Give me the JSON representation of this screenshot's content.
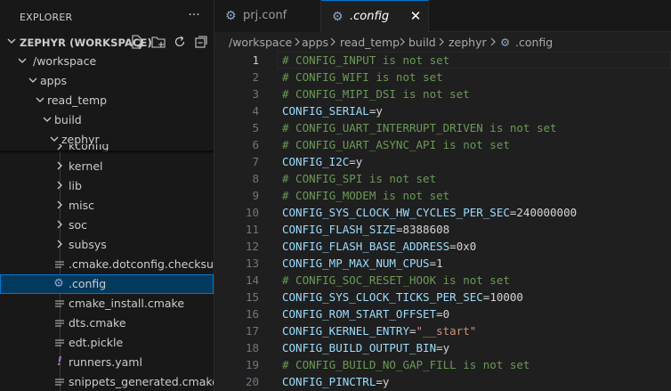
{
  "explorer": {
    "title": "EXPLORER",
    "more_icon": "ellipsis-icon",
    "workspace_label": "ZEPHYR (WORKSPACE)",
    "workspace_actions": [
      "new-file-icon",
      "new-folder-icon",
      "refresh-icon",
      "collapse-all-icon"
    ],
    "tree": [
      {
        "label": "/workspace",
        "type": "folder",
        "expanded": true,
        "depth": 1
      },
      {
        "label": "apps",
        "type": "folder",
        "expanded": true,
        "depth": 2
      },
      {
        "label": "read_temp",
        "type": "folder",
        "expanded": true,
        "depth": 3
      },
      {
        "label": "build",
        "type": "folder",
        "expanded": true,
        "depth": 4
      },
      {
        "label": "zephyr",
        "type": "folder",
        "expanded": true,
        "depth": 5
      },
      {
        "label": "kconfig",
        "type": "folder",
        "expanded": false,
        "depth": 6
      },
      {
        "label": "kernel",
        "type": "folder",
        "expanded": false,
        "depth": 6
      },
      {
        "label": "lib",
        "type": "folder",
        "expanded": false,
        "depth": 6
      },
      {
        "label": "misc",
        "type": "folder",
        "expanded": false,
        "depth": 6
      },
      {
        "label": "soc",
        "type": "folder",
        "expanded": false,
        "depth": 6
      },
      {
        "label": "subsys",
        "type": "folder",
        "expanded": false,
        "depth": 6
      },
      {
        "label": ".cmake.dotconfig.checksum",
        "type": "file",
        "icon": "lines-icon",
        "depth": 6
      },
      {
        "label": ".config",
        "type": "file",
        "icon": "gear-icon",
        "selected": true,
        "depth": 6
      },
      {
        "label": "cmake_install.cmake",
        "type": "file",
        "icon": "lines-icon",
        "depth": 6
      },
      {
        "label": "dts.cmake",
        "type": "file",
        "icon": "lines-icon",
        "depth": 6
      },
      {
        "label": "edt.pickle",
        "type": "file",
        "icon": "lines-icon",
        "depth": 6
      },
      {
        "label": "runners.yaml",
        "type": "file",
        "icon": "exclamation-icon",
        "depth": 6
      },
      {
        "label": "snippets_generated.cmake",
        "type": "file",
        "icon": "lines-icon",
        "depth": 6
      }
    ]
  },
  "tabs": [
    {
      "label": "prj.conf",
      "icon": "gear-icon",
      "active": false
    },
    {
      "label": ".config",
      "icon": "gear-icon",
      "active": true,
      "close_icon": "close-icon"
    }
  ],
  "breadcrumb": [
    "/workspace",
    "apps",
    "read_temp",
    "build",
    "zephyr",
    ".config"
  ],
  "editor": {
    "active_line": 1,
    "lines": [
      {
        "n": "1",
        "kind": "comment",
        "text": "# CONFIG_INPUT is not set"
      },
      {
        "n": "2",
        "kind": "comment",
        "text": "# CONFIG_WIFI is not set"
      },
      {
        "n": "3",
        "kind": "comment",
        "text": "# CONFIG_MIPI_DSI is not set"
      },
      {
        "n": "4",
        "kind": "kv",
        "key": "CONFIG_SERIAL",
        "value": "y"
      },
      {
        "n": "5",
        "kind": "comment",
        "text": "# CONFIG_UART_INTERRUPT_DRIVEN is not set"
      },
      {
        "n": "6",
        "kind": "comment",
        "text": "# CONFIG_UART_ASYNC_API is not set"
      },
      {
        "n": "7",
        "kind": "kv",
        "key": "CONFIG_I2C",
        "value": "y"
      },
      {
        "n": "8",
        "kind": "comment",
        "text": "# CONFIG_SPI is not set"
      },
      {
        "n": "9",
        "kind": "comment",
        "text": "# CONFIG_MODEM is not set"
      },
      {
        "n": "10",
        "kind": "kv",
        "key": "CONFIG_SYS_CLOCK_HW_CYCLES_PER_SEC",
        "value": "240000000"
      },
      {
        "n": "11",
        "kind": "kv",
        "key": "CONFIG_FLASH_SIZE",
        "value": "8388608"
      },
      {
        "n": "12",
        "kind": "kv",
        "key": "CONFIG_FLASH_BASE_ADDRESS",
        "value": "0x0"
      },
      {
        "n": "13",
        "kind": "kv",
        "key": "CONFIG_MP_MAX_NUM_CPUS",
        "value": "1"
      },
      {
        "n": "14",
        "kind": "comment",
        "text": "# CONFIG_SOC_RESET_HOOK is not set"
      },
      {
        "n": "15",
        "kind": "kv",
        "key": "CONFIG_SYS_CLOCK_TICKS_PER_SEC",
        "value": "10000"
      },
      {
        "n": "16",
        "kind": "kv",
        "key": "CONFIG_ROM_START_OFFSET",
        "value": "0"
      },
      {
        "n": "17",
        "kind": "kvs",
        "key": "CONFIG_KERNEL_ENTRY",
        "value": "\"__start\""
      },
      {
        "n": "18",
        "kind": "kv",
        "key": "CONFIG_BUILD_OUTPUT_BIN",
        "value": "y"
      },
      {
        "n": "19",
        "kind": "comment",
        "text": "# CONFIG_BUILD_NO_GAP_FILL is not set"
      },
      {
        "n": "20",
        "kind": "kv",
        "key": "CONFIG_PINCTRL",
        "value": "y"
      }
    ]
  },
  "colors": {
    "accent": "#0078d4",
    "selection": "#04395e",
    "comment": "#6a9955",
    "key": "#9cdcfe",
    "string": "#ce9178",
    "yaml_icon": "#a074c4",
    "gear_icon": "#8fa8c8"
  }
}
